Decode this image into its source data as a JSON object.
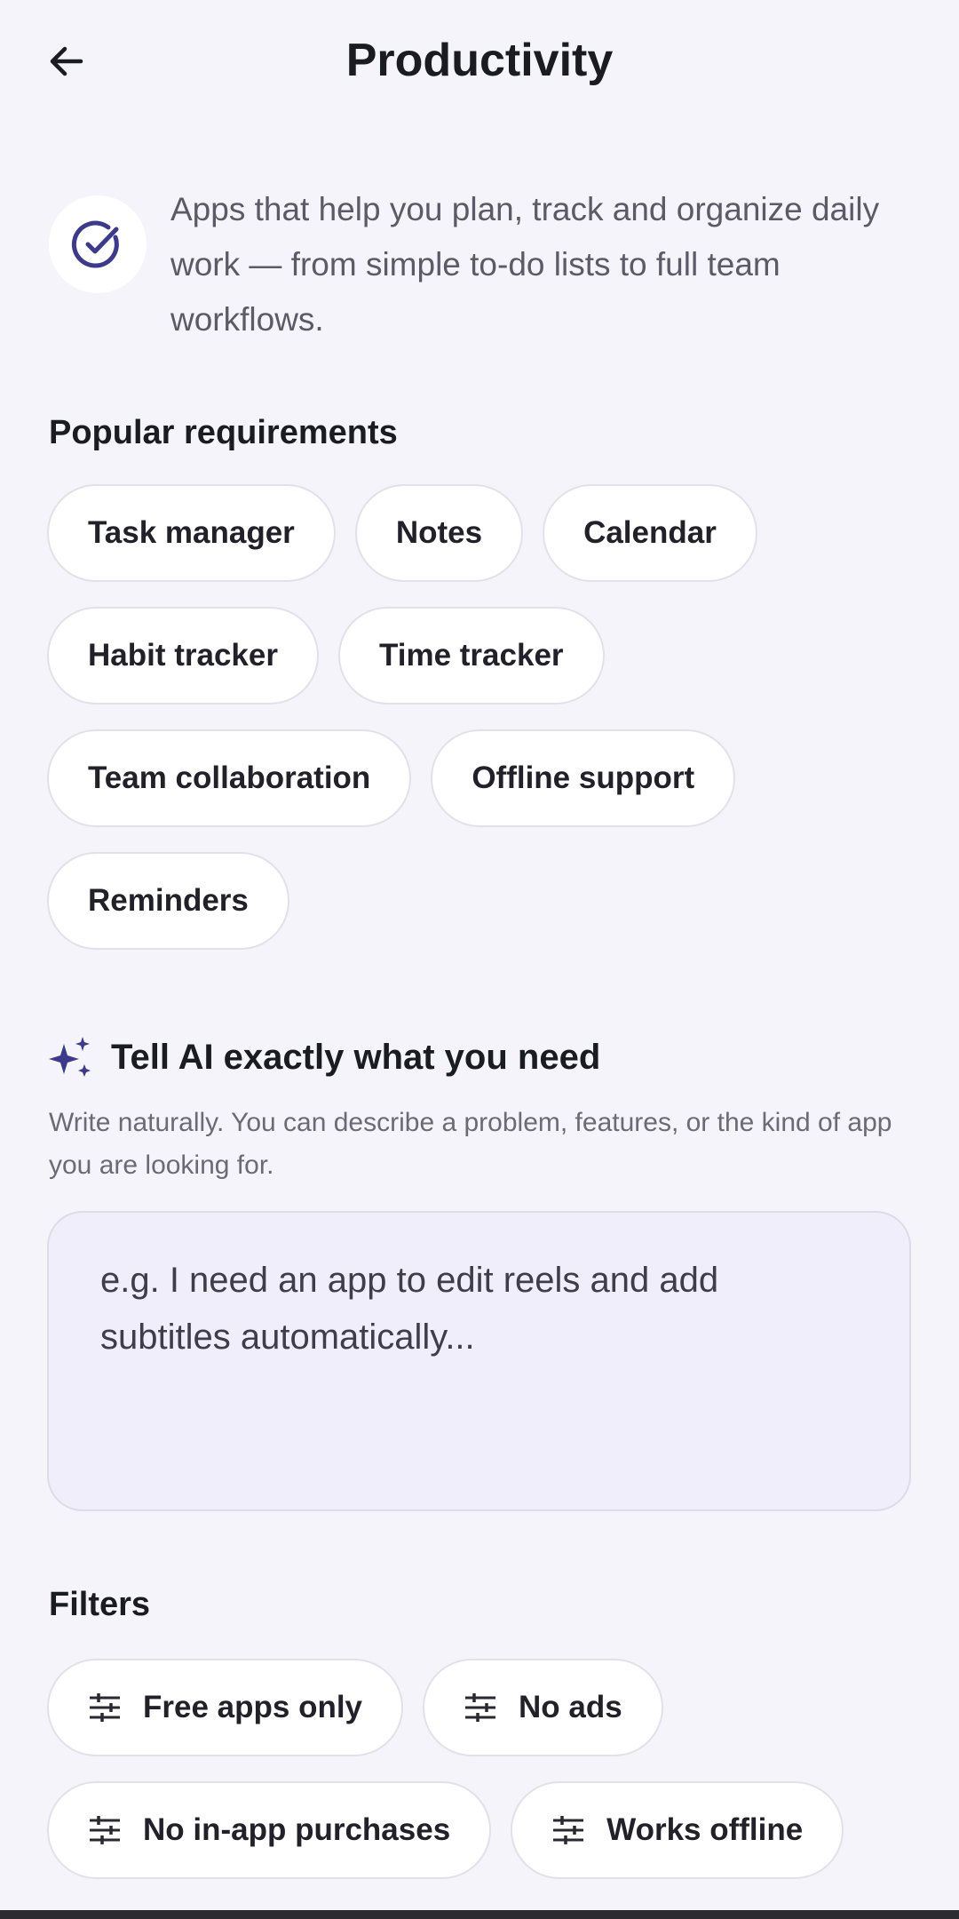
{
  "header": {
    "title": "Productivity"
  },
  "intro": {
    "text": "Apps that help you plan, track and organize daily work — from simple to-do lists to full team workflows."
  },
  "requirements": {
    "title": "Popular requirements",
    "chips": [
      "Task manager",
      "Notes",
      "Calendar",
      "Habit tracker",
      "Time tracker",
      "Team collaboration",
      "Offline support",
      "Reminders"
    ]
  },
  "ai": {
    "title": "Tell AI exactly what you need",
    "helper": "Write naturally. You can describe a problem, features, or the kind of app you are looking for.",
    "placeholder": "e.g. I need an app to edit reels and add subtitles automatically..."
  },
  "filters": {
    "title": "Filters",
    "chips": [
      "Free apps only",
      "No ads",
      "No in-app purchases",
      "Works offline"
    ]
  },
  "colors": {
    "accent": "#3c3a8c",
    "background": "#f5f4fa",
    "chip_border": "#e2e1ea",
    "input_bg": "#efeefa"
  },
  "icons": {
    "back": "arrow-left-icon",
    "intro": "check-circle-icon",
    "ai": "sparkle-icon",
    "filter": "tune-icon"
  }
}
